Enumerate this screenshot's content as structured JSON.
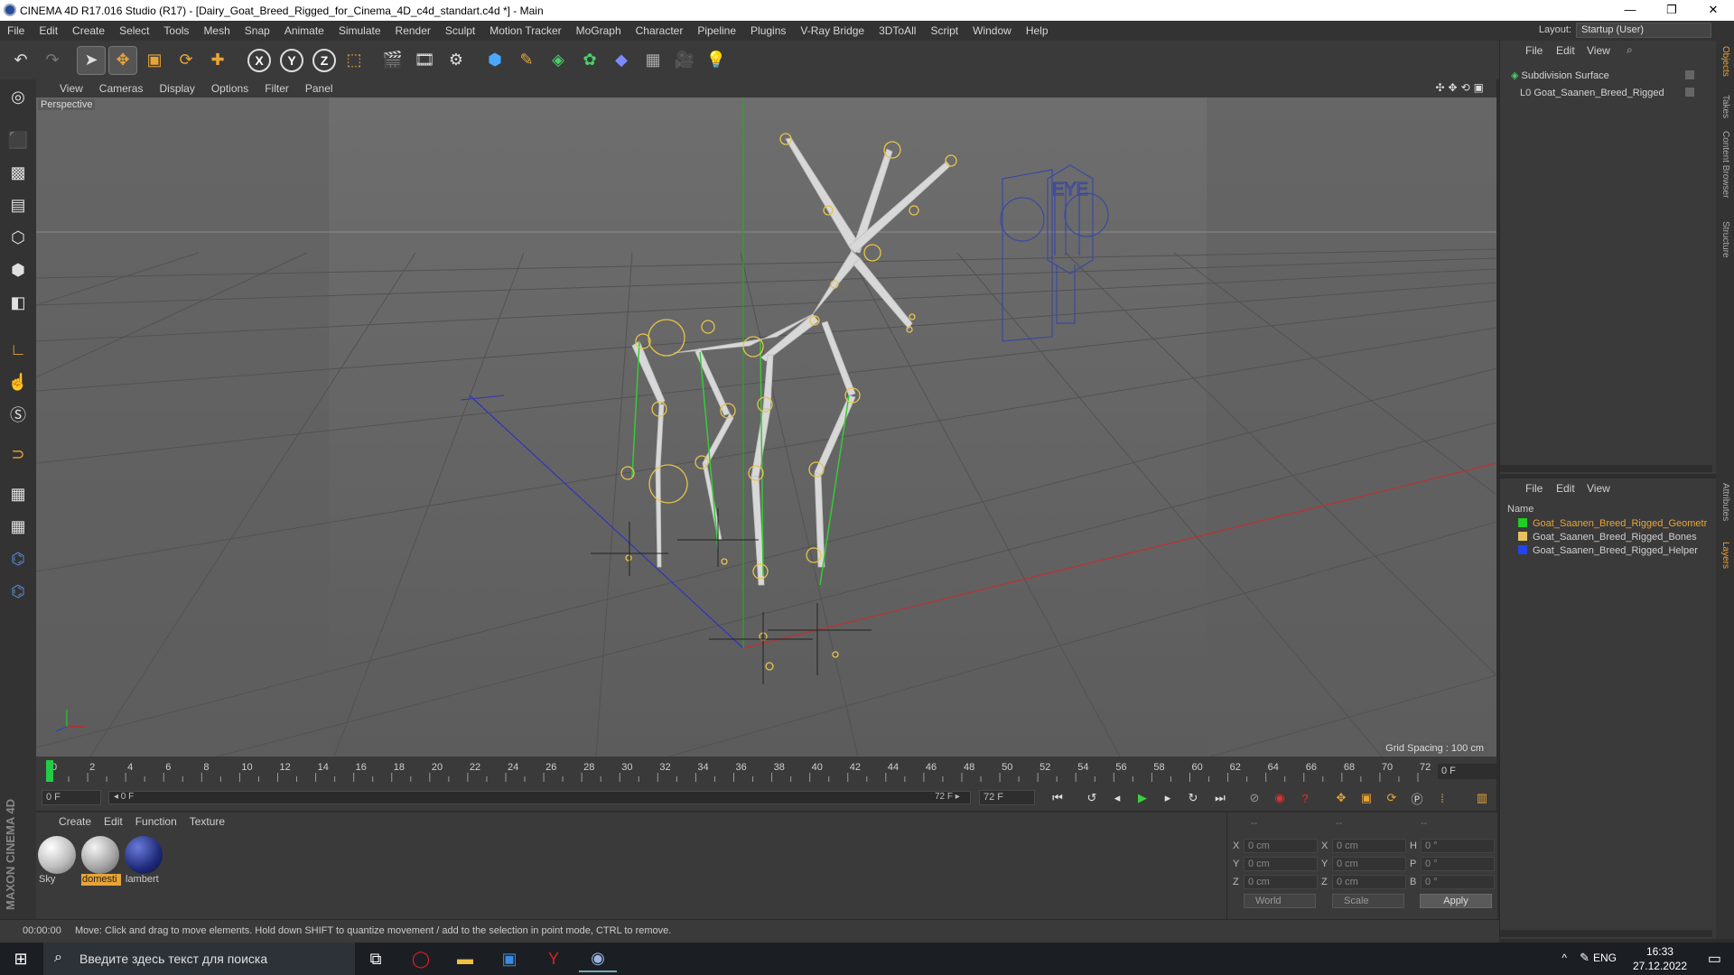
{
  "window": {
    "title": "CINEMA 4D R17.016 Studio (R17) - [Dairy_Goat_Breed_Rigged_for_Cinema_4D_c4d_standart.c4d *] - Main",
    "minimize": "—",
    "restore": "❐",
    "close": "✕"
  },
  "menu": [
    "File",
    "Edit",
    "Create",
    "Select",
    "Tools",
    "Mesh",
    "Snap",
    "Animate",
    "Simulate",
    "Render",
    "Sculpt",
    "Motion Tracker",
    "MoGraph",
    "Character",
    "Pipeline",
    "Plugins",
    "V-Ray Bridge",
    "3DToAll",
    "Script",
    "Window",
    "Help"
  ],
  "layout": {
    "label": "Layout:",
    "value": "Startup (User)"
  },
  "viewport": {
    "menu": [
      "View",
      "Cameras",
      "Display",
      "Options",
      "Filter",
      "Panel"
    ],
    "label": "Perspective",
    "grid_spacing": "Grid Spacing : 100 cm",
    "nav_icons": "✣✥⟲▣"
  },
  "timeline": {
    "ticks": [
      "0",
      "2",
      "4",
      "6",
      "8",
      "10",
      "12",
      "14",
      "16",
      "18",
      "20",
      "22",
      "24",
      "26",
      "28",
      "30",
      "32",
      "34",
      "36",
      "38",
      "40",
      "42",
      "44",
      "46",
      "48",
      "50",
      "52",
      "54",
      "56",
      "58",
      "60",
      "62",
      "64",
      "66",
      "68",
      "70",
      "72"
    ],
    "current_frame": 0,
    "max_frame": 72,
    "frame_field": "0 F"
  },
  "transport": {
    "start_field": "0 F",
    "range_start": "◂ 0 F",
    "range_end": "72 F ▸",
    "end_field": "72 F"
  },
  "materials": {
    "menu": [
      "Create",
      "Edit",
      "Function",
      "Texture"
    ],
    "items": [
      {
        "label": "Sky",
        "color": "#e8e8e8",
        "selected": false
      },
      {
        "label": "domesti",
        "color": "#d0d0d0",
        "selected": true
      },
      {
        "label": "lambert",
        "color": "#2a3a8c",
        "selected": false
      }
    ]
  },
  "coords": {
    "header": [
      "--",
      "--",
      "--"
    ],
    "rows": [
      {
        "a": "X",
        "av": "0 cm",
        "b": "X",
        "bv": "0 cm",
        "c": "H",
        "cv": "0 °"
      },
      {
        "a": "Y",
        "av": "0 cm",
        "b": "Y",
        "bv": "0 cm",
        "c": "P",
        "cv": "0 °"
      },
      {
        "a": "Z",
        "av": "0 cm",
        "b": "Z",
        "bv": "0 cm",
        "c": "B",
        "cv": "0 °"
      }
    ],
    "mode": "World",
    "type": "Scale",
    "apply": "Apply"
  },
  "status": {
    "time": "00:00:00",
    "message": "Move: Click and drag to move elements. Hold down SHIFT to quantize movement / add to the selection in point mode, CTRL to remove."
  },
  "objects": {
    "menu": [
      "File",
      "Edit",
      "View"
    ],
    "items": [
      {
        "name": "Subdivision Surface",
        "indent": 0
      },
      {
        "name": "Goat_Saanen_Breed_Rigged",
        "indent": 1
      }
    ]
  },
  "layers": {
    "menu": [
      "File",
      "Edit",
      "View"
    ],
    "header": "Name",
    "items": [
      {
        "name": "Goat_Saanen_Breed_Rigged_Geometr",
        "color": "#22cc22",
        "text_color": "#e8a438"
      },
      {
        "name": "Goat_Saanen_Breed_Rigged_Bones",
        "color": "#e8c060",
        "text_color": "#d0d0d0"
      },
      {
        "name": "Goat_Saanen_Breed_Rigged_Helper",
        "color": "#2244ee",
        "text_color": "#d0d0d0"
      }
    ]
  },
  "right_tabs": [
    "Objects",
    "Takes",
    "Content Browser",
    "Structure",
    "Attributes",
    "Layers"
  ],
  "taskbar": {
    "search_placeholder": "Введите здесь текст для поиска",
    "lang": "ENG",
    "time": "16:33",
    "date": "27.12.2022"
  },
  "maxon": "MAXON CINEMA 4D"
}
